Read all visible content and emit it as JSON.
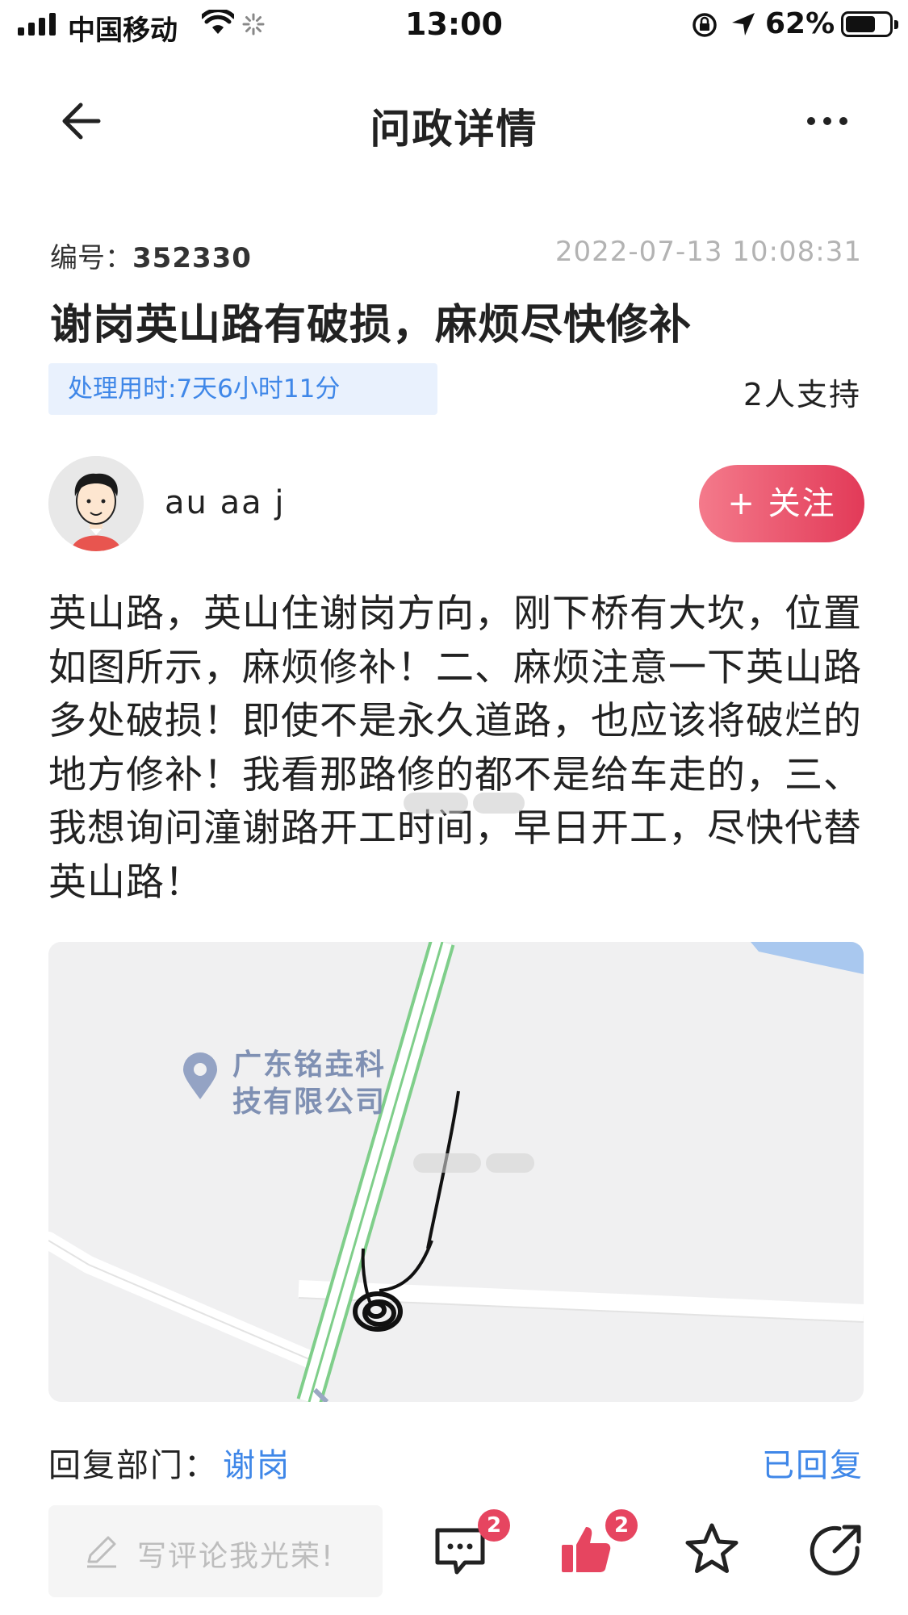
{
  "status_bar": {
    "carrier": "中国移动",
    "time": "13:00",
    "battery": "62%",
    "icons": [
      "signal-icon",
      "wifi-icon",
      "loading-icon",
      "rotation-lock-icon",
      "location-icon",
      "battery-icon"
    ]
  },
  "nav": {
    "title": "问政详情",
    "back_icon": "back-arrow-icon",
    "more_icon": "more-dots-icon"
  },
  "post": {
    "ticket_label": "编号：",
    "ticket_number": "352330",
    "timestamp": "2022-07-13 10:08:31",
    "title": "谢岗英山路有破损，麻烦尽快修补",
    "process_time": "处理用时:7天6小时11分",
    "support": "2人支持",
    "author": "au aa j",
    "follow_label": "+ 关注",
    "content": "英山路，英山住谢岗方向，刚下桥有大坎，位置如图所示，麻烦修补！二、麻烦注意一下英山路多处破损！即使不是永久道路，也应该将破烂的地方修补！我看那路修的都不是给车走的，三、我想询问潼谢路开工时间，早日开工，尽快代替英山路！",
    "map_label": "广东铭垚科技有限公司"
  },
  "reply": {
    "label": "回复部门：",
    "department": "谢岗",
    "status": "已回复"
  },
  "bottom_bar": {
    "comment_placeholder": "写评论我光荣!",
    "comment_count": "2",
    "like_count": "2",
    "icons": [
      "pencil-icon",
      "comment-icon",
      "thumbs-up-icon",
      "star-icon",
      "share-icon"
    ]
  },
  "colors": {
    "accent_blue": "#3f87e8",
    "follow_gradient_start": "#f47a8b",
    "follow_gradient_end": "#e23a58",
    "badge_red": "#e64560",
    "like_red": "#e64560"
  }
}
